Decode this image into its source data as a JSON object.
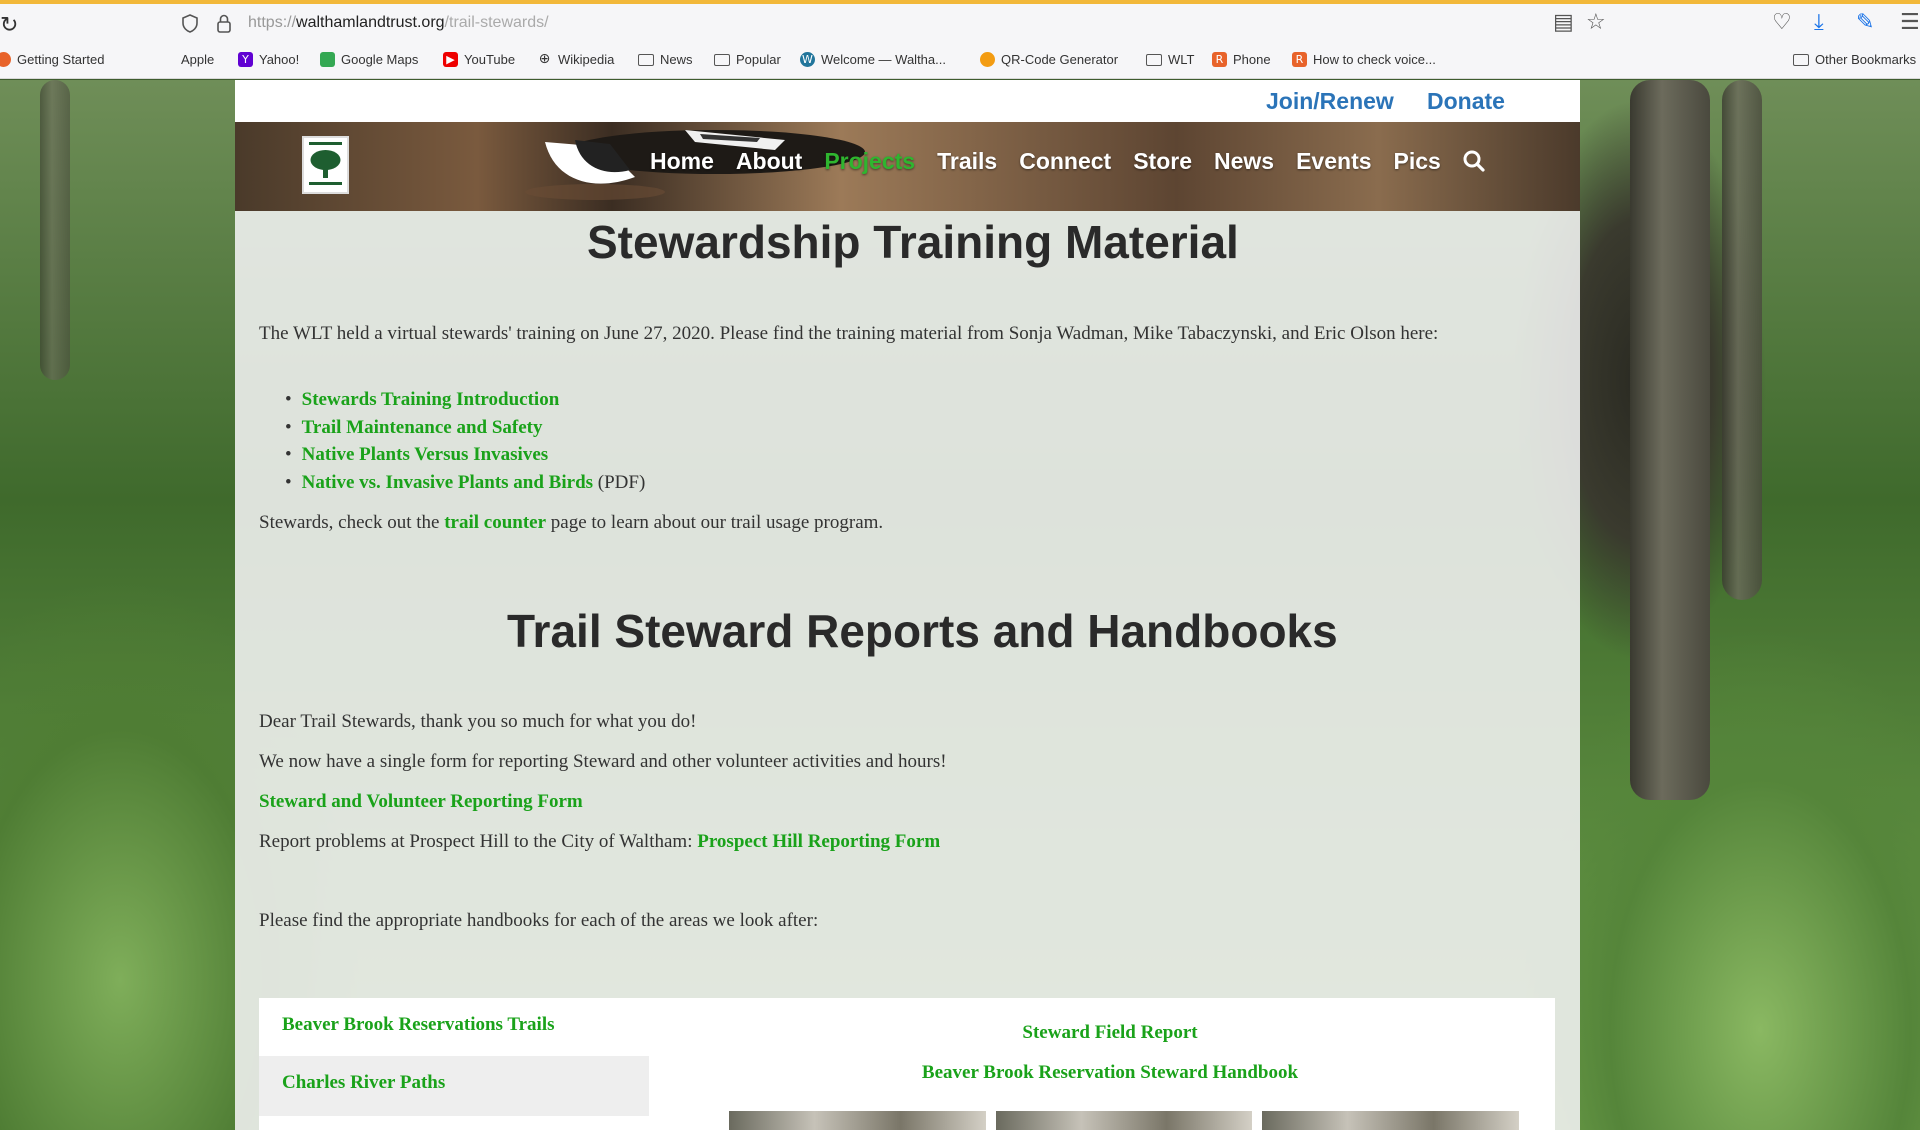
{
  "browser": {
    "url_scheme": "https://",
    "url_host": "walthamlandtrust.org",
    "url_path": "/trail-stewards/",
    "bookmarks": [
      {
        "label": "Getting Started",
        "icon": "firefox-icon"
      },
      {
        "label": "Apple",
        "icon": "apple-icon"
      },
      {
        "label": "Yahoo!",
        "icon": "yahoo-icon"
      },
      {
        "label": "Google Maps",
        "icon": "google-maps-icon"
      },
      {
        "label": "YouTube",
        "icon": "youtube-icon"
      },
      {
        "label": "Wikipedia",
        "icon": "globe-icon"
      },
      {
        "label": "News",
        "icon": "folder-icon"
      },
      {
        "label": "Popular",
        "icon": "folder-icon"
      },
      {
        "label": "Welcome — Waltha...",
        "icon": "wordpress-icon"
      },
      {
        "label": "QR-Code Generator",
        "icon": "qr-icon"
      },
      {
        "label": "WLT",
        "icon": "folder-icon"
      },
      {
        "label": "Phone",
        "icon": "phone-icon"
      },
      {
        "label": "How to check voice...",
        "icon": "voicemail-icon"
      },
      {
        "label": "Other Bookmarks",
        "icon": "folder-icon"
      }
    ]
  },
  "site": {
    "top_links": {
      "join": "Join/Renew",
      "donate": "Donate"
    },
    "nav": [
      "Home",
      "About",
      "Projects",
      "Trails",
      "Connect",
      "Store",
      "News",
      "Events",
      "Pics"
    ],
    "active_nav": "Projects",
    "section1": {
      "title": "Stewardship Training Material",
      "intro": "The WLT held a virtual stewards' training on June 27, 2020. Please find the training material from Sonja Wadman, Mike Tabaczynski, and Eric Olson here:",
      "materials": [
        {
          "label": "Stewards Training Introduction",
          "suffix": ""
        },
        {
          "label": "Trail Maintenance and Safety",
          "suffix": ""
        },
        {
          "label": "Native Plants Versus Invasives",
          "suffix": ""
        },
        {
          "label": "Native vs. Invasive Plants and Birds",
          "suffix": " (PDF)"
        }
      ],
      "counter_pre": "Stewards, check out the ",
      "counter_link": "trail counter",
      "counter_post": " page to learn about our trail usage program."
    },
    "section2": {
      "title": "Trail Steward Reports and Handbooks",
      "thanks": "Dear Trail Stewards, thank you so much for what you do!",
      "single_form": "We now have a single form for reporting Steward and other volunteer activities and hours!",
      "form_link": "Steward and Volunteer Reporting Form",
      "prospect_pre": "Report problems at Prospect Hill to the City of Waltham: ",
      "prospect_link": "Prospect Hill Reporting Form",
      "handbooks_intro": "Please find the appropriate handbooks for each of the areas we look after:",
      "tabs": [
        "Beaver Brook Reservations Trails",
        "Charles River Paths"
      ],
      "pane_links": [
        "Steward Field Report",
        "Beaver Brook Reservation Steward Handbook"
      ]
    },
    "colors": {
      "link_green": "#1aa21a",
      "top_link_blue": "#2b74b8",
      "accent_bar": "#f2b83a"
    }
  }
}
